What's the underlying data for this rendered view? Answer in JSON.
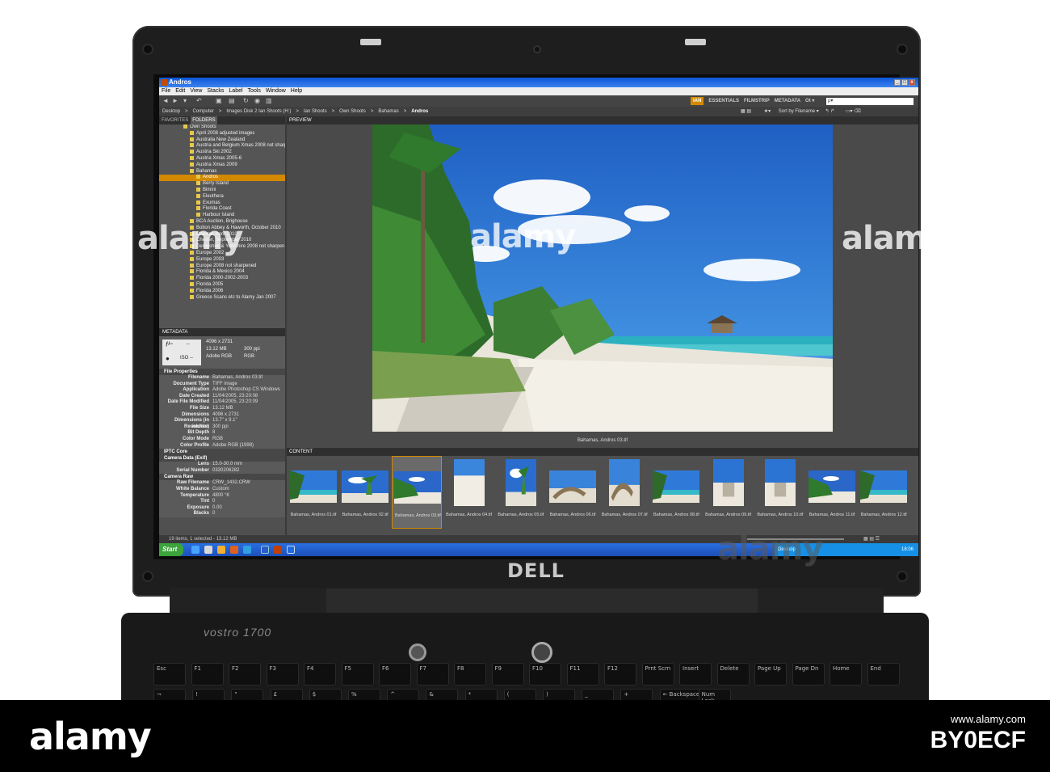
{
  "window": {
    "title": "Andros",
    "buttons": [
      "_",
      "□",
      "x"
    ]
  },
  "menu": [
    "File",
    "Edit",
    "View",
    "Stacks",
    "Label",
    "Tools",
    "Window",
    "Help"
  ],
  "workspaces": {
    "active": "IAN",
    "items": [
      "ESSENTIALS",
      "FILMSTRIP",
      "METADATA"
    ],
    "more": "Ot ▾"
  },
  "search": {
    "placeholder": "ρ▾"
  },
  "path": [
    "Desktop",
    "Computer",
    "Images Disk 2 Ian Shoots (H:)",
    "Ian Shoots",
    "Own Shoots",
    "Bahamas",
    "Andros"
  ],
  "sort": {
    "label": "Sort by Filename ▾"
  },
  "panels": {
    "favorites": "FAVORITES",
    "folders": "FOLDERS",
    "preview": "PREVIEW",
    "metadata": "METADATA",
    "content": "CONTENT"
  },
  "folders": [
    {
      "name": "Own Shoots",
      "indent": 0
    },
    {
      "name": "April 2008 adjusted images",
      "indent": 1
    },
    {
      "name": "Australia New Zealand",
      "indent": 1
    },
    {
      "name": "Austria and Belgium Xmas 2008 not sharp",
      "indent": 1
    },
    {
      "name": "Austria Ski 2002",
      "indent": 1
    },
    {
      "name": "Austria Xmas 2005-6",
      "indent": 1
    },
    {
      "name": "Austria Xmas 2009",
      "indent": 1
    },
    {
      "name": "Bahamas",
      "indent": 1
    },
    {
      "name": "Andros",
      "indent": 2,
      "selected": true
    },
    {
      "name": "Berry Island",
      "indent": 2
    },
    {
      "name": "Bimini",
      "indent": 2
    },
    {
      "name": "Eleuthera",
      "indent": 2
    },
    {
      "name": "Exumas",
      "indent": 2
    },
    {
      "name": "Florida Coast",
      "indent": 2
    },
    {
      "name": "Harbour Island",
      "indent": 2
    },
    {
      "name": "BCA Auction, Brighouse",
      "indent": 1
    },
    {
      "name": "Bolton Abbey & Haworth, October 2010",
      "indent": 1
    },
    {
      "name": "Chester, April 2010",
      "indent": 1
    },
    {
      "name": "Chester, September 2010",
      "indent": 1
    },
    {
      "name": "Derbyshire & Yorkshire 2008 not sharpen",
      "indent": 1
    },
    {
      "name": "Europe 2002",
      "indent": 1
    },
    {
      "name": "Europe 2003",
      "indent": 1
    },
    {
      "name": "Europe 2008 not sharpened",
      "indent": 1
    },
    {
      "name": "Florida & Mexico 2004",
      "indent": 1
    },
    {
      "name": "Florida 2000-2002-2003",
      "indent": 1
    },
    {
      "name": "Florida 2005",
      "indent": 1
    },
    {
      "name": "Florida 2006",
      "indent": 1
    },
    {
      "name": "Greece Scans etc to Alamy Jan 2007",
      "indent": 1
    }
  ],
  "summary": {
    "aperture": "ƒ/--",
    "shutter": "--",
    "iso": "ISO --",
    "dims": "4096 x 2731",
    "size": "13.12 MB",
    "res": "300 ppi",
    "profile": "Adobe RGB",
    "mode": "RGB"
  },
  "metadata": {
    "file_properties_title": "File Properties",
    "file_properties": [
      [
        "Filename",
        "Bahamas, Andros 03.tif"
      ],
      [
        "Document Type",
        "TIFF image"
      ],
      [
        "Application",
        "Adobe Photoshop CS Windows"
      ],
      [
        "Date Created",
        "11/04/2005, 23:20:08"
      ],
      [
        "Date File Modified",
        "11/04/2005, 23:20:09"
      ],
      [
        "File Size",
        "13.12 MB"
      ],
      [
        "Dimensions",
        "4096 x 2731"
      ],
      [
        "Dimensions (in inches)",
        "13.7\" x 9.1\""
      ],
      [
        "Resolution",
        "300 ppi"
      ],
      [
        "Bit Depth",
        "8"
      ],
      [
        "Color Mode",
        "RGB"
      ],
      [
        "Color Profile",
        "Adobe RGB (1998)"
      ]
    ],
    "iptc_title": "IPTC Core",
    "camera_title": "Camera Data (Exif)",
    "camera": [
      [
        "Lens",
        "15.0-30.0 mm"
      ],
      [
        "Serial Number",
        "0330206282"
      ]
    ],
    "raw_title": "Camera Raw",
    "raw": [
      [
        "Raw Filename",
        "CRW_1432.CRW"
      ],
      [
        "White Balance",
        "Custom"
      ],
      [
        "Temperature",
        "4800 °K"
      ],
      [
        "Tint",
        "0"
      ],
      [
        "Exposure",
        "0.00"
      ],
      [
        "Blacks",
        "0"
      ]
    ]
  },
  "preview_caption": "Bahamas, Andros 03.tif",
  "thumbnails": [
    {
      "name": "Bahamas, Andros 01.tif",
      "orient": "land",
      "scene": "a"
    },
    {
      "name": "Bahamas, Andros 02.tif",
      "orient": "land",
      "scene": "b"
    },
    {
      "name": "Bahamas, Andros 03.tif",
      "orient": "land",
      "scene": "c",
      "selected": true
    },
    {
      "name": "Bahamas, Andros 04.tif",
      "orient": "port",
      "scene": "d"
    },
    {
      "name": "Bahamas, Andros 05.tif",
      "orient": "port",
      "scene": "b"
    },
    {
      "name": "Bahamas, Andros 06.tif",
      "orient": "land",
      "scene": "e"
    },
    {
      "name": "Bahamas, Andros 07.tif",
      "orient": "port",
      "scene": "e"
    },
    {
      "name": "Bahamas, Andros 08.tif",
      "orient": "land",
      "scene": "a"
    },
    {
      "name": "Bahamas, Andros 09.tif",
      "orient": "port",
      "scene": "f"
    },
    {
      "name": "Bahamas, Andros 10.tif",
      "orient": "port",
      "scene": "f"
    },
    {
      "name": "Bahamas, Andros 11.tif",
      "orient": "land",
      "scene": "c"
    },
    {
      "name": "Bahamas, Andros 12.tif",
      "orient": "land",
      "scene": "a"
    }
  ],
  "status": "19 items, 1 selected - 13.12 MB",
  "taskbar": {
    "start": "Start",
    "desktop": "Desktop",
    "clock": "18:06"
  },
  "laptop": {
    "logo": "DELL",
    "model": "vostro 1700"
  },
  "keyboard": [
    {
      "row": 0,
      "labels": [
        "Esc",
        "F1",
        "F2",
        "F3",
        "F4",
        "F5",
        "F6",
        "F7",
        "F8",
        "F9",
        "F10",
        "F11",
        "F12",
        "Prnt Scrn",
        "Insert",
        "Delete",
        "Page Up",
        "Page Dn",
        "Home",
        "End"
      ]
    },
    {
      "row": 1,
      "labels": [
        "¬",
        "!",
        "\"",
        "£",
        "$",
        "%",
        "^",
        "&",
        "*",
        "(",
        ")",
        "_",
        "+",
        "← Backspace",
        "Num Lock"
      ]
    }
  ],
  "watermark": {
    "text": "alamy",
    "bottom_id": "BY0ECF",
    "bottom_url": "www.alamy.com"
  }
}
